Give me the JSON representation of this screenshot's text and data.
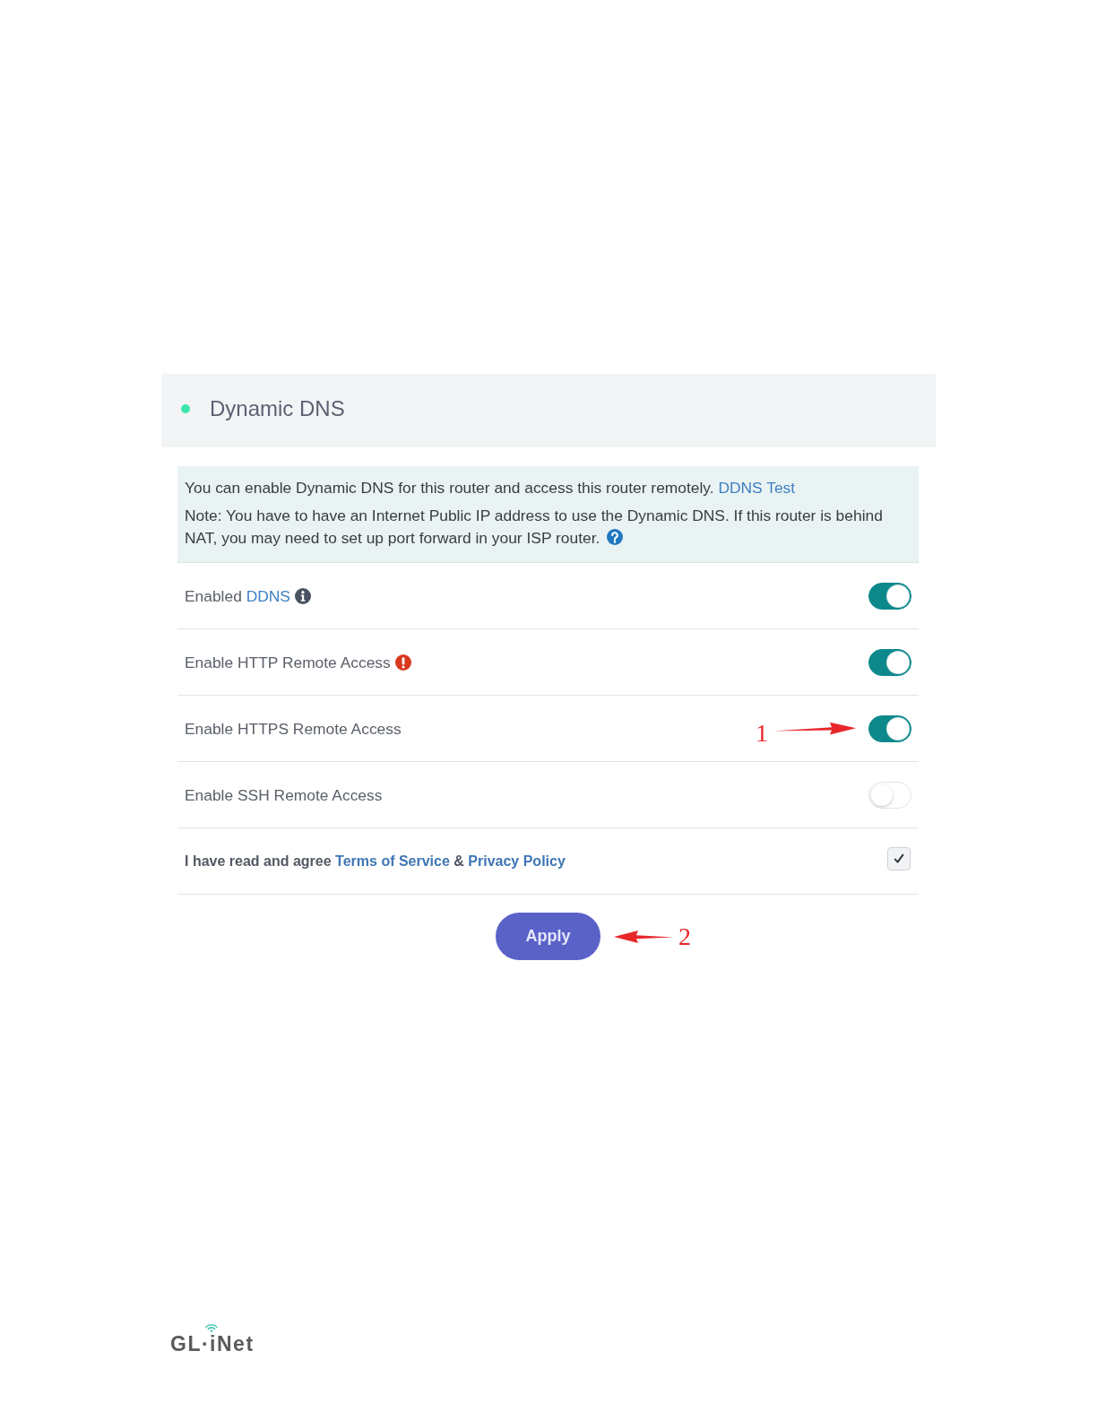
{
  "section": {
    "title": "Dynamic DNS"
  },
  "notice": {
    "intro": "You can enable Dynamic DNS for this router and access this router remotely.",
    "intro_link": "DDNS Test",
    "note": "Note: You have to have an Internet Public IP address to use the Dynamic DNS. If this router is behind NAT, you may need to set up port forward in your ISP router."
  },
  "settings": [
    {
      "kind": "toggle",
      "label": "Enabled",
      "link": "DDNS",
      "info": true,
      "on": true
    },
    {
      "kind": "toggle",
      "label": "Enable HTTP Remote Access",
      "warning": true,
      "on": true
    },
    {
      "kind": "toggle",
      "label": "Enable HTTPS Remote Access",
      "on": true,
      "callout": "1"
    },
    {
      "kind": "toggle",
      "label": "Enable SSH Remote Access",
      "on": false
    },
    {
      "kind": "checkbox",
      "label": "I have read and agree",
      "links": [
        "Terms of Service",
        "Privacy Policy"
      ],
      "joiner": "&",
      "checked": true
    }
  ],
  "apply_button": {
    "label": "Apply",
    "callout": "2"
  },
  "footer": {
    "logo": "GL·iNet"
  }
}
